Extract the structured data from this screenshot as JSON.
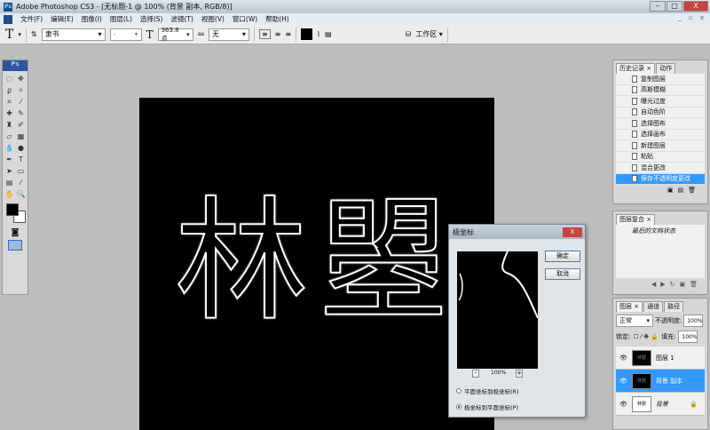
{
  "window": {
    "app_icon": "Ps",
    "title": "Adobe Photoshop CS3 - [无标题-1 @ 100% (背景 副本, RGB/8)]",
    "min": "–",
    "max": "□",
    "close": "X"
  },
  "menu": [
    "文件(F)",
    "编辑(E)",
    "图像(I)",
    "图层(L)",
    "选择(S)",
    "滤镜(T)",
    "视图(V)",
    "窗口(W)",
    "帮助(H)"
  ],
  "menu_right": "_ ▫ x",
  "options": {
    "tool": "T",
    "font_family": "隶书",
    "font_style": "-",
    "font_size": "363.8 点",
    "antialias_icon": "aa",
    "antialias": "无",
    "workspace": "工作区 ▾"
  },
  "toolbox": {
    "logo": "Ps"
  },
  "canvas": {
    "text": "林曌"
  },
  "history": {
    "tabs": [
      "历史记录 ×",
      "动作"
    ],
    "items": [
      "复制图层",
      "高斯模糊",
      "曝光过度",
      "自动色阶",
      "选择图布",
      "选择画布",
      "新建图层",
      "粘贴",
      "混合更改",
      "保存不透明度更改"
    ],
    "selected": 9
  },
  "comps": {
    "tab": "图层复合 ×",
    "item": "最后的文档状态"
  },
  "layers": {
    "tabs": [
      "图层 ×",
      "通道",
      "路径"
    ],
    "blend": "正常",
    "opacity_label": "不透明度:",
    "opacity": "100%",
    "lock_label": "锁定:",
    "fill_label": "填充:",
    "fill": "100%",
    "items": [
      {
        "name": "图层 1",
        "thumb": "林曌"
      },
      {
        "name": "背景 副本",
        "thumb": "林曌"
      },
      {
        "name": "背景",
        "thumb": "林曌"
      }
    ],
    "selected": 1
  },
  "dialog": {
    "title": "极坐标",
    "ok": "确定",
    "cancel": "取消",
    "zoom": "100%",
    "minus": "-",
    "plus": "+",
    "opt1": "平面坐标到极坐标(R)",
    "opt2": "极坐标到平面坐标(P)",
    "selected": 2
  }
}
